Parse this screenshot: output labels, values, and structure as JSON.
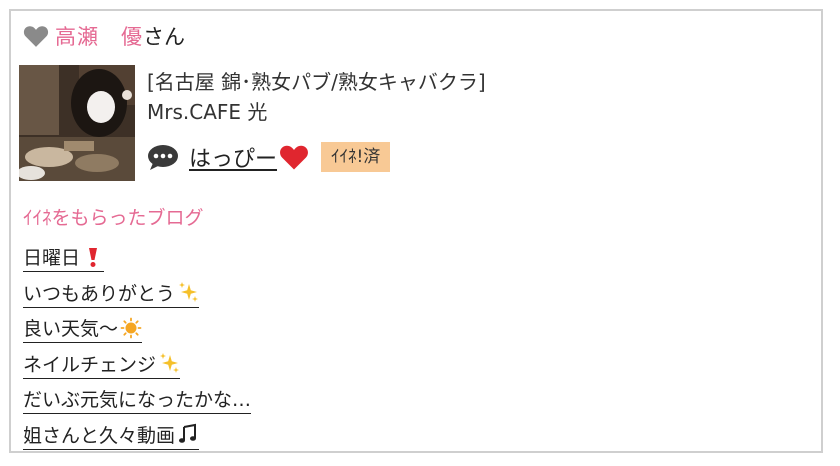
{
  "header": {
    "name": "高瀬　優",
    "suffix": "さん",
    "heart_icon": "heart-icon",
    "heart_color": "#8a8a8a"
  },
  "profile": {
    "category": "[名古屋 錦･熟女パブ/熟女キャバクラ]",
    "shop_name": "Mrs.CAFE 光",
    "comment_text": "はっぴー",
    "comment_emoji": "red-heart",
    "badge_label": "ｲｲﾈ!済"
  },
  "blog_section": {
    "title": "ｲｲﾈをもらったブログ",
    "items": [
      {
        "label": "日曜日",
        "emoji": "exclamation"
      },
      {
        "label": "いつもありがとう",
        "emoji": "sparkles"
      },
      {
        "label": "良い天気〜",
        "emoji": "sun"
      },
      {
        "label": "ネイルチェンジ",
        "emoji": "sparkles"
      },
      {
        "label": "だいぶ元気になったかな…",
        "emoji": ""
      },
      {
        "label": "姐さんと久々動画",
        "emoji": "music-notes"
      }
    ]
  },
  "colors": {
    "accent_pink": "#e56a93",
    "badge_bg": "#f8c995",
    "border": "#cfcfcf"
  }
}
